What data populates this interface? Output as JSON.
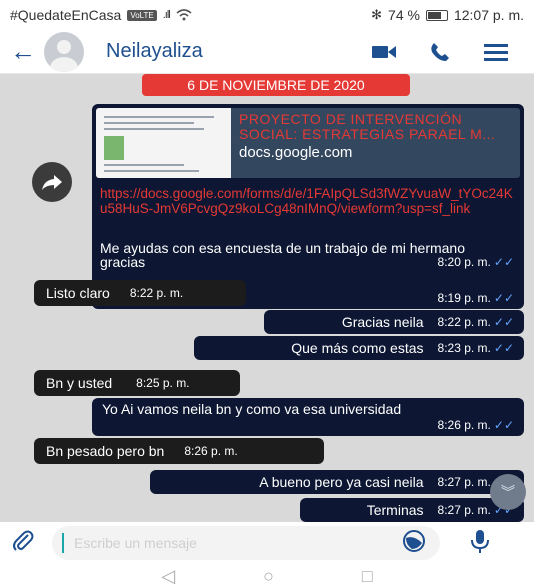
{
  "status_bar": {
    "hashtag": "#QuedateEnCasa",
    "badge": "VoLTE",
    "signal_glyph": ".ıll",
    "battery": "74 %",
    "battery_level_percent": 74,
    "time": "12:07 p. m."
  },
  "header": {
    "contact_name": "Neilayaliza"
  },
  "chat": {
    "date_label": "6 DE NOVIEMBRE DE 2020",
    "link_message": {
      "preview_title": "PROYECTO DE INTERVENCIÓN SOCIAL: ESTRATEGIAS PARAEL M...",
      "preview_domain": "docs.google.com",
      "url": "https://docs.google.com/forms/d/e/1FAIpQLSd3fWZYvuaW_tYOc24Ku58HuS-JmV6PcvgQz9koLCg48nIMnQ/viewform?usp=sf_link",
      "time": "8:19 p. m."
    },
    "messages": [
      {
        "direction": "out",
        "text": "Me ayudas con esa encuesta de un trabajo de mi hermano gracias",
        "time": "8:20 p. m."
      },
      {
        "direction": "in",
        "text": "Listo claro",
        "time": "8:22 p. m."
      },
      {
        "direction": "out",
        "text": "Gracias neila",
        "time": "8:22 p. m."
      },
      {
        "direction": "out",
        "text": "Que más como estas",
        "time": "8:23 p. m."
      },
      {
        "direction": "in",
        "text": "Bn y usted",
        "time": "8:25 p. m."
      },
      {
        "direction": "out",
        "text": "Yo Ai vamos neila bn y como va esa universidad",
        "time": "8:26 p. m."
      },
      {
        "direction": "in",
        "text": "Bn pesado pero bn",
        "time": "8:26 p. m."
      },
      {
        "direction": "out",
        "text": "A bueno pero ya casi neila",
        "time": "8:27 p. m."
      },
      {
        "direction": "out",
        "text": "Terminas",
        "time": "8:27 p. m."
      }
    ]
  },
  "input": {
    "placeholder": "Escribe un mensaje"
  },
  "icons": {
    "back": "arrow-left-icon",
    "video": "video-camera-icon",
    "call": "phone-icon",
    "menu": "hamburger-menu-icon",
    "share": "share-arrow-icon",
    "attach": "paperclip-icon",
    "sticker": "sticker-icon",
    "mic": "microphone-icon",
    "scroll": "chevron-double-down-icon"
  },
  "colors": {
    "accent_blue": "#1e4f8f",
    "date_red": "#e53935",
    "bubble_out": "#0d1733",
    "bubble_in": "#1c1c1c",
    "chat_bg": "#d9d9d9",
    "read_ticks": "#64a4ff"
  }
}
